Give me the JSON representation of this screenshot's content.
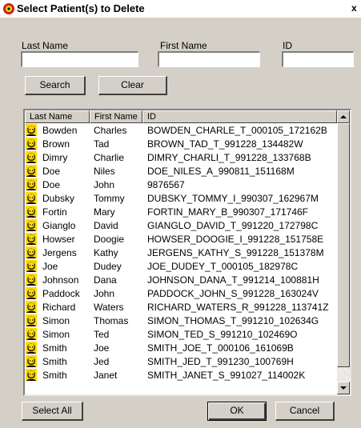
{
  "window": {
    "title": "Select Patient(s) to Delete",
    "close_glyph": "x"
  },
  "filters": {
    "last_name": {
      "label": "Last Name",
      "value": ""
    },
    "first_name": {
      "label": "First Name",
      "value": ""
    },
    "id": {
      "label": "ID",
      "value": ""
    }
  },
  "buttons": {
    "search": "Search",
    "clear": "Clear",
    "select_all": "Select All",
    "ok": "OK",
    "cancel": "Cancel"
  },
  "list": {
    "columns": [
      "Last Name",
      "First Name",
      "ID"
    ],
    "rows": [
      [
        "Bowden",
        "Charles",
        "BOWDEN_CHARLE_T_000105_172162B"
      ],
      [
        "Brown",
        "Tad",
        "BROWN_TAD_T_991228_134482W"
      ],
      [
        "Dimry",
        "Charlie",
        "DIMRY_CHARLI_T_991228_133768B"
      ],
      [
        "Doe",
        "Niles",
        "DOE_NILES_A_990811_151168M"
      ],
      [
        "Doe",
        "John",
        "9876567"
      ],
      [
        "Dubsky",
        "Tommy",
        "DUBSKY_TOMMY_I_990307_162967M"
      ],
      [
        "Fortin",
        "Mary",
        "FORTIN_MARY_B_990307_171746F"
      ],
      [
        "Gianglo",
        "David",
        "GIANGLO_DAVID_T_991220_172798C"
      ],
      [
        "Howser",
        "Doogie",
        "HOWSER_DOOGIE_I_991228_151758E"
      ],
      [
        "Jergens",
        "Kathy",
        "JERGENS_KATHY_S_991228_151378M"
      ],
      [
        "Joe",
        "Dudey",
        "JOE_DUDEY_T_000105_182978C"
      ],
      [
        "Johnson",
        "Dana",
        "JOHNSON_DANA_T_991214_100881H"
      ],
      [
        "Paddock",
        "John",
        "PADDOCK_JOHN_S_991228_163024V"
      ],
      [
        "Richard",
        "Waters",
        "RICHARD_WATERS_R_991228_113741Z"
      ],
      [
        "Simon",
        "Thomas",
        "SIMON_THOMAS_T_991210_102634G"
      ],
      [
        "Simon",
        "Ted",
        "SIMON_TED_S_991210_102469O"
      ],
      [
        "Smith",
        "Joe",
        "SMITH_JOE_T_000106_161069B"
      ],
      [
        "Smith",
        "Jed",
        "SMITH_JED_T_991230_100769H"
      ],
      [
        "Smith",
        "Janet",
        "SMITH_JANET_S_991027_114002K"
      ]
    ]
  },
  "icons": {
    "app": "patient-app-icon",
    "row": "patient-icon"
  },
  "colors": {
    "dialog_bg": "#d4d0c8",
    "patient_icon_face": "#ffd800"
  }
}
